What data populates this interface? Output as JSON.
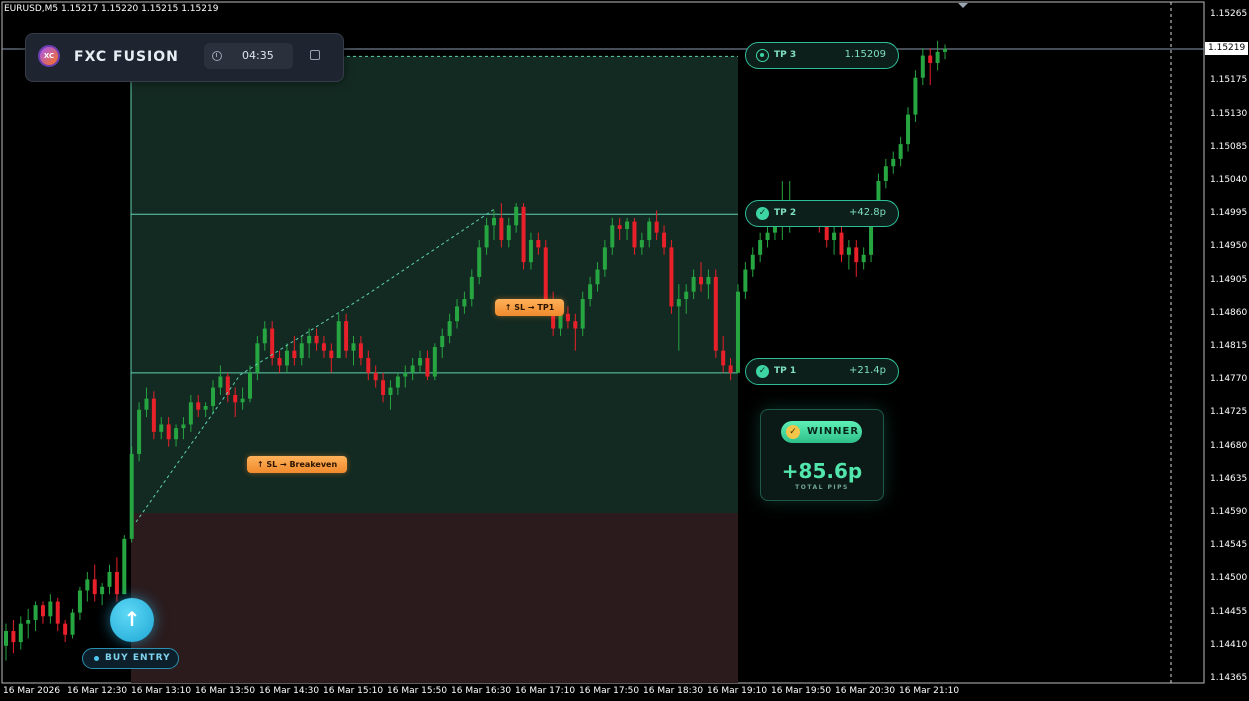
{
  "symbol_header": "EURUSD,M5  1.15217 1.15220 1.15215 1.15219",
  "current_price": "1.15219",
  "price_axis": [
    "1.15265",
    "1.15219",
    "1.15175",
    "1.15130",
    "1.15085",
    "1.15040",
    "1.14995",
    "1.14950",
    "1.14905",
    "1.14860",
    "1.14815",
    "1.14770",
    "1.14725",
    "1.14680",
    "1.14635",
    "1.14590",
    "1.14545",
    "1.14500",
    "1.14455",
    "1.14410",
    "1.14365"
  ],
  "time_axis": [
    "16 Mar 2026",
    "16 Mar 12:30",
    "16 Mar 13:10",
    "16 Mar 13:50",
    "16 Mar 14:30",
    "16 Mar 15:10",
    "16 Mar 15:50",
    "16 Mar 16:30",
    "16 Mar 17:10",
    "16 Mar 17:50",
    "16 Mar 18:30",
    "16 Mar 19:10",
    "16 Mar 19:50",
    "16 Mar 20:30",
    "16 Mar 21:10"
  ],
  "panel": {
    "brand": "FXC FUSION",
    "logo": "XC",
    "timer": "04:35"
  },
  "targets": [
    {
      "label": "TP 3",
      "value": "1.15209",
      "icon": "target-icon"
    },
    {
      "label": "TP 2",
      "value": "+42.8p",
      "icon": "check-icon"
    },
    {
      "label": "TP 1",
      "value": "+21.4p",
      "icon": "check-icon"
    }
  ],
  "badges": {
    "sl_breakeven": "SL → Breakeven",
    "sl_tp1": "SL → TP1"
  },
  "result": {
    "label": "WINNER",
    "pips": "+85.6p",
    "pips_label": "TOTAL PIPS"
  },
  "entry": {
    "label": "BUY ENTRY"
  },
  "colors": {
    "bull": "#26a541",
    "bear": "#e8202a",
    "profit_zone": "#132a22",
    "loss_zone": "#2b1b1c",
    "tp_line": "#5fd0b0"
  },
  "chart_data": {
    "type": "candlestick",
    "title": "",
    "ylim": [
      1.14365,
      1.15265
    ],
    "entry_price": 1.1459,
    "targets": {
      "tp1": 1.1478,
      "tp2": 1.14995,
      "tp3": 1.15209
    },
    "candles": [
      [
        1.1441,
        1.1444,
        1.1439,
        1.1443
      ],
      [
        1.1443,
        1.14445,
        1.144,
        1.14415
      ],
      [
        1.14415,
        1.1445,
        1.14405,
        1.1444
      ],
      [
        1.1444,
        1.1446,
        1.1442,
        1.14445
      ],
      [
        1.14445,
        1.1447,
        1.1443,
        1.14465
      ],
      [
        1.14465,
        1.1447,
        1.1444,
        1.1445
      ],
      [
        1.1445,
        1.1448,
        1.1444,
        1.1447
      ],
      [
        1.1447,
        1.14475,
        1.1443,
        1.1444
      ],
      [
        1.1444,
        1.14445,
        1.14415,
        1.14425
      ],
      [
        1.14425,
        1.1446,
        1.1442,
        1.14455
      ],
      [
        1.14455,
        1.1449,
        1.14445,
        1.14485
      ],
      [
        1.14485,
        1.1451,
        1.1447,
        1.145
      ],
      [
        1.145,
        1.1452,
        1.1447,
        1.1448
      ],
      [
        1.1448,
        1.14495,
        1.14465,
        1.1449
      ],
      [
        1.1449,
        1.1452,
        1.1448,
        1.1451
      ],
      [
        1.1451,
        1.1453,
        1.1447,
        1.1448
      ],
      [
        1.1448,
        1.1456,
        1.1448,
        1.14555
      ],
      [
        1.14555,
        1.1468,
        1.1455,
        1.1467
      ],
      [
        1.1467,
        1.1474,
        1.1466,
        1.1473
      ],
      [
        1.1473,
        1.1476,
        1.1472,
        1.14745
      ],
      [
        1.14745,
        1.14755,
        1.1469,
        1.147
      ],
      [
        1.147,
        1.1472,
        1.1469,
        1.1471
      ],
      [
        1.1471,
        1.1472,
        1.1468,
        1.1469
      ],
      [
        1.1469,
        1.1471,
        1.1468,
        1.14705
      ],
      [
        1.14705,
        1.1472,
        1.1469,
        1.1471
      ],
      [
        1.1471,
        1.1475,
        1.147,
        1.1474
      ],
      [
        1.1474,
        1.1475,
        1.1472,
        1.1473
      ],
      [
        1.1473,
        1.1474,
        1.1472,
        1.14735
      ],
      [
        1.14735,
        1.1477,
        1.14725,
        1.1476
      ],
      [
        1.1476,
        1.1479,
        1.1475,
        1.14775
      ],
      [
        1.14775,
        1.1478,
        1.1474,
        1.1475
      ],
      [
        1.1475,
        1.1476,
        1.1472,
        1.1474
      ],
      [
        1.1474,
        1.1476,
        1.1473,
        1.14745
      ],
      [
        1.14745,
        1.1479,
        1.1474,
        1.1478
      ],
      [
        1.1478,
        1.1483,
        1.1477,
        1.1482
      ],
      [
        1.1482,
        1.1485,
        1.1481,
        1.1484
      ],
      [
        1.1484,
        1.1485,
        1.1479,
        1.148
      ],
      [
        1.148,
        1.1481,
        1.1478,
        1.1479
      ],
      [
        1.1479,
        1.1482,
        1.1478,
        1.1481
      ],
      [
        1.1481,
        1.1483,
        1.1479,
        1.148
      ],
      [
        1.148,
        1.1483,
        1.1479,
        1.1482
      ],
      [
        1.1482,
        1.1484,
        1.148,
        1.1483
      ],
      [
        1.1483,
        1.1484,
        1.1481,
        1.1482
      ],
      [
        1.1482,
        1.1483,
        1.148,
        1.1481
      ],
      [
        1.1481,
        1.1482,
        1.1478,
        1.148
      ],
      [
        1.148,
        1.1486,
        1.148,
        1.1485
      ],
      [
        1.1485,
        1.1486,
        1.148,
        1.1481
      ],
      [
        1.1481,
        1.1483,
        1.1479,
        1.1482
      ],
      [
        1.1482,
        1.1483,
        1.1479,
        1.148
      ],
      [
        1.148,
        1.1481,
        1.1477,
        1.1478
      ],
      [
        1.1478,
        1.1479,
        1.1476,
        1.1477
      ],
      [
        1.1477,
        1.1478,
        1.1474,
        1.1475
      ],
      [
        1.1475,
        1.1477,
        1.1473,
        1.1476
      ],
      [
        1.1476,
        1.1478,
        1.1475,
        1.14775
      ],
      [
        1.14775,
        1.1479,
        1.1476,
        1.1478
      ],
      [
        1.1478,
        1.148,
        1.1477,
        1.1479
      ],
      [
        1.1479,
        1.1481,
        1.1478,
        1.148
      ],
      [
        1.148,
        1.1481,
        1.1477,
        1.14775
      ],
      [
        1.14775,
        1.1482,
        1.1477,
        1.14815
      ],
      [
        1.14815,
        1.1484,
        1.148,
        1.1483
      ],
      [
        1.1483,
        1.1486,
        1.1482,
        1.1485
      ],
      [
        1.1485,
        1.1488,
        1.1484,
        1.1487
      ],
      [
        1.1487,
        1.1489,
        1.1486,
        1.1488
      ],
      [
        1.1488,
        1.1492,
        1.1487,
        1.1491
      ],
      [
        1.1491,
        1.1496,
        1.149,
        1.1495
      ],
      [
        1.1495,
        1.1499,
        1.1494,
        1.1498
      ],
      [
        1.1498,
        1.15,
        1.1496,
        1.1499
      ],
      [
        1.1499,
        1.1501,
        1.1495,
        1.1496
      ],
      [
        1.1496,
        1.1499,
        1.1495,
        1.1498
      ],
      [
        1.1498,
        1.1501,
        1.1497,
        1.15005
      ],
      [
        1.15005,
        1.1501,
        1.1492,
        1.1493
      ],
      [
        1.1493,
        1.1497,
        1.1492,
        1.1496
      ],
      [
        1.1496,
        1.1497,
        1.1494,
        1.1495
      ],
      [
        1.1495,
        1.1496,
        1.1487,
        1.1488
      ],
      [
        1.1488,
        1.1489,
        1.1483,
        1.1484
      ],
      [
        1.1484,
        1.1487,
        1.1483,
        1.1486
      ],
      [
        1.1486,
        1.1487,
        1.1484,
        1.1485
      ],
      [
        1.1485,
        1.1486,
        1.1481,
        1.1484
      ],
      [
        1.1484,
        1.1489,
        1.1483,
        1.1488
      ],
      [
        1.1488,
        1.1491,
        1.1487,
        1.149
      ],
      [
        1.149,
        1.1493,
        1.1489,
        1.1492
      ],
      [
        1.1492,
        1.1496,
        1.1491,
        1.1495
      ],
      [
        1.1495,
        1.1499,
        1.1494,
        1.1498
      ],
      [
        1.1498,
        1.1499,
        1.1496,
        1.14975
      ],
      [
        1.14975,
        1.1499,
        1.1496,
        1.14985
      ],
      [
        1.14985,
        1.1499,
        1.1494,
        1.1495
      ],
      [
        1.1495,
        1.1497,
        1.1494,
        1.1496
      ],
      [
        1.1496,
        1.1499,
        1.1495,
        1.14985
      ],
      [
        1.14985,
        1.15,
        1.1496,
        1.1497
      ],
      [
        1.1497,
        1.1498,
        1.1494,
        1.1495
      ],
      [
        1.1495,
        1.1496,
        1.1486,
        1.1487
      ],
      [
        1.1487,
        1.149,
        1.1481,
        1.1488
      ],
      [
        1.1488,
        1.149,
        1.1486,
        1.1489
      ],
      [
        1.1489,
        1.1492,
        1.1488,
        1.1491
      ],
      [
        1.1491,
        1.1493,
        1.1489,
        1.149
      ],
      [
        1.149,
        1.1492,
        1.1488,
        1.1491
      ],
      [
        1.1491,
        1.1492,
        1.148,
        1.1481
      ],
      [
        1.1481,
        1.1483,
        1.1478,
        1.1479
      ],
      [
        1.1479,
        1.148,
        1.1477,
        1.1478
      ],
      [
        1.1478,
        1.149,
        1.1478,
        1.1489
      ],
      [
        1.1489,
        1.1493,
        1.1488,
        1.1492
      ],
      [
        1.1492,
        1.1495,
        1.1491,
        1.1494
      ],
      [
        1.1494,
        1.1497,
        1.1493,
        1.1496
      ],
      [
        1.1496,
        1.1498,
        1.1495,
        1.1497
      ],
      [
        1.1497,
        1.1499,
        1.1496,
        1.1498
      ],
      [
        1.1498,
        1.1504,
        1.1496,
        1.1499
      ],
      [
        1.1499,
        1.1504,
        1.1497,
        1.15
      ],
      [
        1.15,
        1.1501,
        1.1498,
        1.1499
      ],
      [
        1.1499,
        1.1501,
        1.1498,
        1.15
      ],
      [
        1.15,
        1.1501,
        1.1498,
        1.14995
      ],
      [
        1.14995,
        1.15,
        1.1497,
        1.1498
      ],
      [
        1.1498,
        1.1499,
        1.1495,
        1.1496
      ],
      [
        1.1496,
        1.1498,
        1.1494,
        1.1497
      ],
      [
        1.1497,
        1.1498,
        1.1493,
        1.1494
      ],
      [
        1.1494,
        1.1496,
        1.1492,
        1.1495
      ],
      [
        1.1495,
        1.1496,
        1.1491,
        1.1493
      ],
      [
        1.1493,
        1.1495,
        1.1492,
        1.1494
      ],
      [
        1.1494,
        1.15,
        1.1493,
        1.1499
      ],
      [
        1.1499,
        1.1505,
        1.1498,
        1.1504
      ],
      [
        1.1504,
        1.1507,
        1.1503,
        1.1506
      ],
      [
        1.1506,
        1.1508,
        1.1505,
        1.1507
      ],
      [
        1.1507,
        1.151,
        1.1506,
        1.1509
      ],
      [
        1.1509,
        1.1514,
        1.1508,
        1.1513
      ],
      [
        1.1513,
        1.1519,
        1.1512,
        1.1518
      ],
      [
        1.1518,
        1.1522,
        1.1517,
        1.1521
      ],
      [
        1.1521,
        1.1522,
        1.1517,
        1.152
      ],
      [
        1.152,
        1.1523,
        1.1519,
        1.15215
      ],
      [
        1.15215,
        1.15225,
        1.15205,
        1.15219
      ]
    ]
  }
}
